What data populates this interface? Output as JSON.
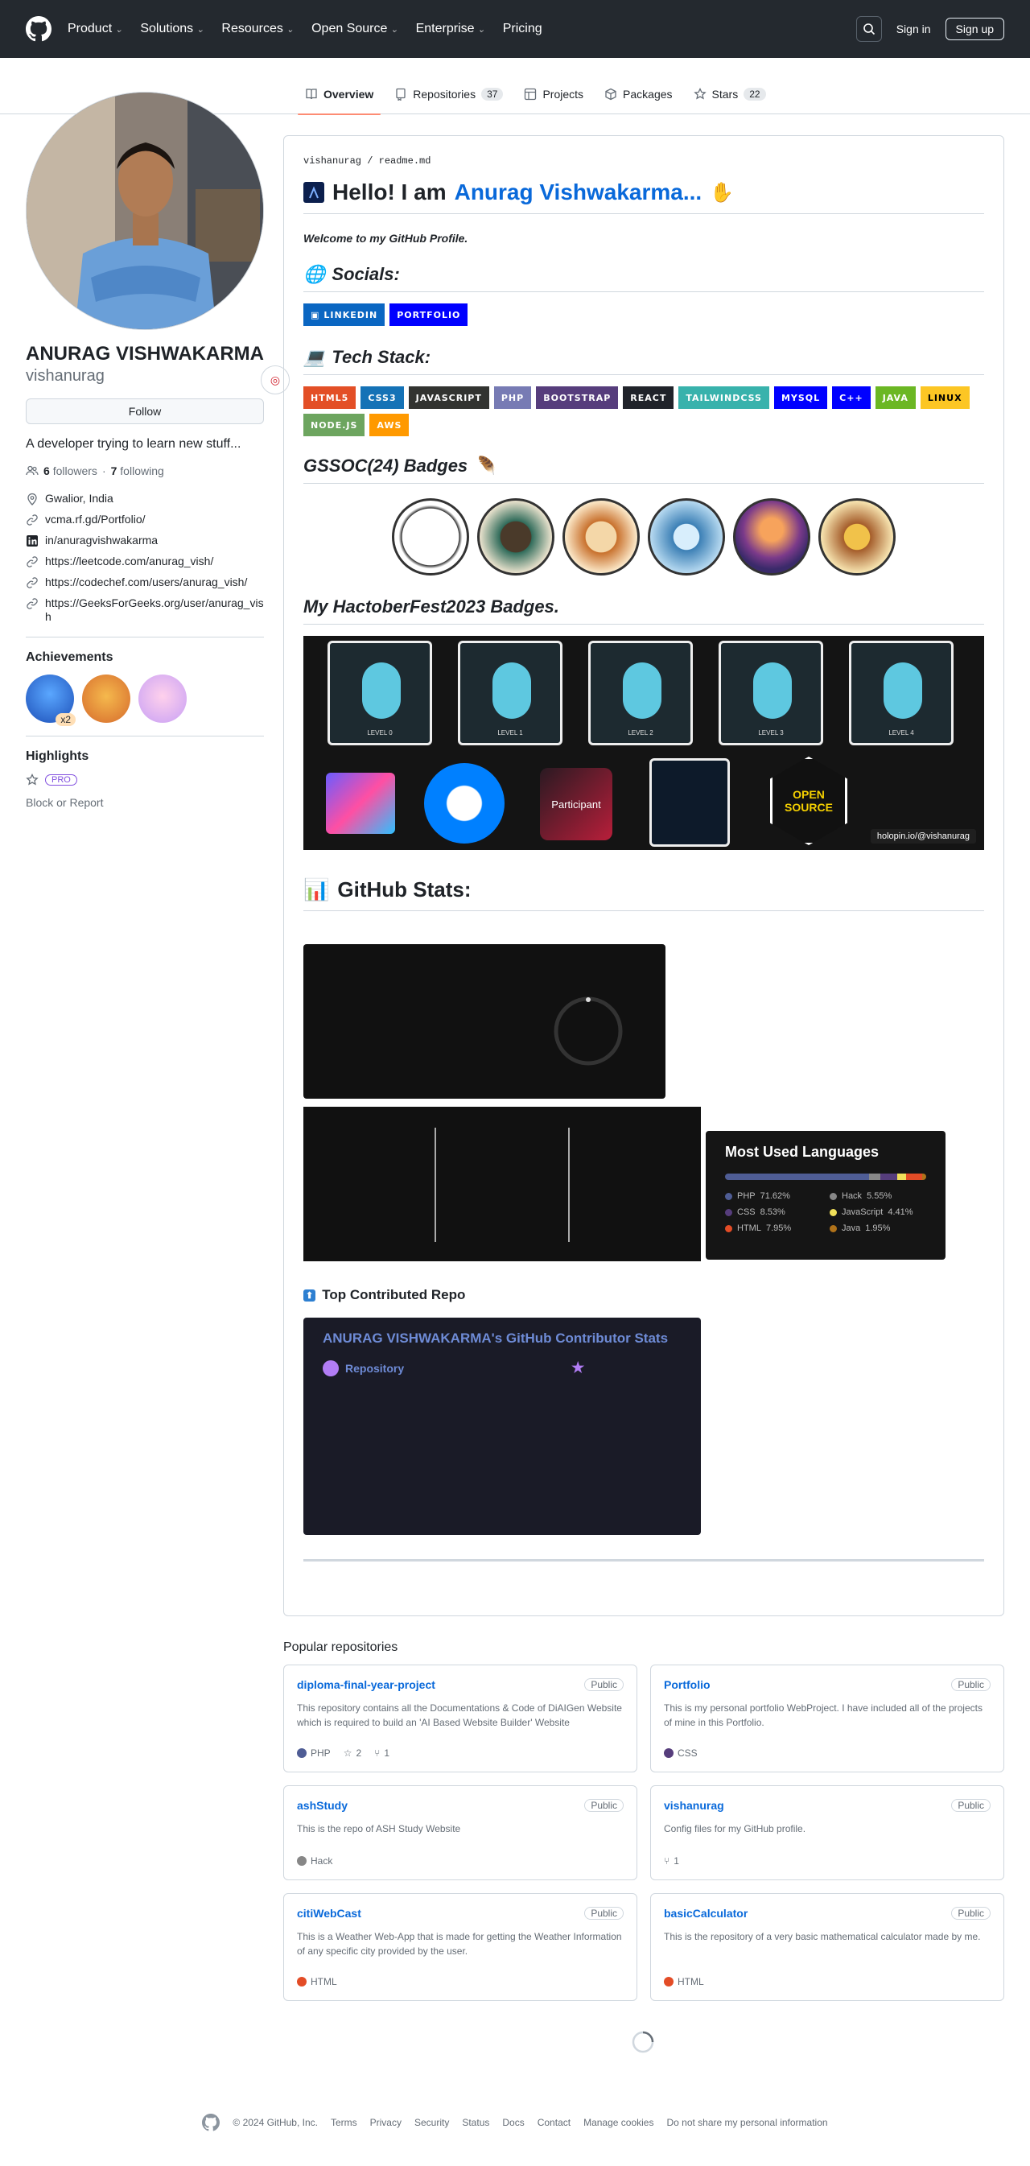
{
  "header": {
    "nav": [
      "Product",
      "Solutions",
      "Resources",
      "Open Source",
      "Enterprise",
      "Pricing"
    ],
    "sign_in": "Sign in",
    "sign_up": "Sign up"
  },
  "tabs": [
    {
      "label": "Overview",
      "icon": "book-icon",
      "selected": true
    },
    {
      "label": "Repositories",
      "count": "37",
      "icon": "repo-icon"
    },
    {
      "label": "Projects",
      "icon": "table-icon"
    },
    {
      "label": "Packages",
      "icon": "package-icon"
    },
    {
      "label": "Stars",
      "count": "22",
      "icon": "star-icon"
    }
  ],
  "profile": {
    "name": "ANURAG VISHWAKARMA",
    "login": "vishanurag",
    "follow_label": "Follow",
    "bio": "A developer trying to learn new stuff...",
    "followers": "6",
    "followers_label": "followers",
    "following": "7",
    "following_label": "following",
    "links": [
      {
        "icon": "location-icon",
        "text": "Gwalior, India"
      },
      {
        "icon": "link-icon",
        "text": "vcma.rf.gd/Portfolio/"
      },
      {
        "icon": "linkedin-icon",
        "text": "in/anuragvishwakarma"
      },
      {
        "icon": "link-icon",
        "text": "https://leetcode.com/anurag_vish/"
      },
      {
        "icon": "link-icon",
        "text": "https://codechef.com/users/anurag_vish/"
      },
      {
        "icon": "link-icon",
        "text": "https://GeeksForGeeks.org/user/anurag_vish"
      }
    ],
    "achievements_title": "Achievements",
    "achievement_count": "x2",
    "highlights_title": "Highlights",
    "pro": "PRO",
    "block": "Block or Report"
  },
  "readme": {
    "path_user": "vishanurag",
    "path_file": "readme.md",
    "hello": "Hello! I am",
    "hello_name": "Anurag Vishwakarma...",
    "welcome": "Welcome to my GitHub Profile.",
    "socials_title": "Socials:",
    "socials": [
      {
        "label": "LINKEDIN",
        "color": "#0a66c2"
      },
      {
        "label": "PORTFOLIO",
        "color": "#0000ff"
      }
    ],
    "tech_title": "Tech Stack:",
    "tech": [
      {
        "label": "HTML5",
        "color": "#e34f26"
      },
      {
        "label": "CSS3",
        "color": "#1572b6"
      },
      {
        "label": "JAVASCRIPT",
        "color": "#323330"
      },
      {
        "label": "PHP",
        "color": "#777bb4"
      },
      {
        "label": "BOOTSTRAP",
        "color": "#563d7c"
      },
      {
        "label": "REACT",
        "color": "#20232a"
      },
      {
        "label": "TAILWINDCSS",
        "color": "#38b2ac"
      },
      {
        "label": "MYSQL",
        "color": "#0000ff"
      },
      {
        "label": "C++",
        "color": "#0000ff"
      },
      {
        "label": "JAVA",
        "color": "#6bb723"
      },
      {
        "label": "LINUX",
        "color": "#fcc624"
      },
      {
        "label": "NODE.JS",
        "color": "#6da55f"
      },
      {
        "label": "AWS",
        "color": "#ff9900"
      }
    ],
    "gssoc_title": "GSSOC(24) Badges",
    "hacktober_title": "My HactoberFest2023 Badges.",
    "holopin": {
      "levels": [
        "LEVEL 0",
        "LEVEL 1",
        "LEVEL 2",
        "LEVEL 3",
        "LEVEL 4"
      ],
      "participant_badge": "Participant",
      "open_source_badge": "OPEN SOURCE",
      "credit": "holopin.io/@vishanurag"
    },
    "stats_title": "GitHub Stats:",
    "languages": {
      "title": "Most Used Languages",
      "items": [
        {
          "name": "PHP",
          "pct": "71.62%",
          "value": 71.62,
          "color": "#4f5d95"
        },
        {
          "name": "Hack",
          "pct": "5.55%",
          "value": 5.55,
          "color": "#878787"
        },
        {
          "name": "CSS",
          "pct": "8.53%",
          "value": 8.53,
          "color": "#563d7c"
        },
        {
          "name": "JavaScript",
          "pct": "4.41%",
          "value": 4.41,
          "color": "#f1e05a"
        },
        {
          "name": "HTML",
          "pct": "7.95%",
          "value": 7.95,
          "color": "#e34c26"
        },
        {
          "name": "Java",
          "pct": "1.95%",
          "value": 1.95,
          "color": "#b07219"
        }
      ]
    },
    "top_repo_title": "Top Contributed Repo",
    "contrib_title": "ANURAG VISHWAKARMA's GitHub Contributor Stats",
    "contrib_repo_label": "Repository"
  },
  "popular": {
    "title": "Popular repositories",
    "public": "Public",
    "repos": [
      {
        "name": "diploma-final-year-project",
        "desc": "This repository contains all the Documentations & Code of DiAIGen Website which is required to build an 'AI Based Website Builder' Website",
        "lang": "PHP",
        "lang_color": "#4f5d95",
        "stars": "2",
        "forks": "1"
      },
      {
        "name": "Portfolio",
        "desc": "This is my personal portfolio WebProject. I have included all of the projects of mine in this Portfolio.",
        "lang": "CSS",
        "lang_color": "#563d7c"
      },
      {
        "name": "ashStudy",
        "desc": "This is the repo of ASH Study Website",
        "lang": "Hack",
        "lang_color": "#878787"
      },
      {
        "name": "vishanurag",
        "desc": "Config files for my GitHub profile.",
        "forks": "1"
      },
      {
        "name": "citiWebCast",
        "desc": "This is a Weather Web-App that is made for getting the Weather Information of any specific city provided by the user.",
        "lang": "HTML",
        "lang_color": "#e34c26"
      },
      {
        "name": "basicCalculator",
        "desc": "This is the repository of a very basic mathematical calculator made by me.",
        "lang": "HTML",
        "lang_color": "#e34c26"
      }
    ]
  },
  "footer": {
    "copyright": "© 2024 GitHub, Inc.",
    "links": [
      "Terms",
      "Privacy",
      "Security",
      "Status",
      "Docs",
      "Contact",
      "Manage cookies",
      "Do not share my personal information"
    ]
  }
}
